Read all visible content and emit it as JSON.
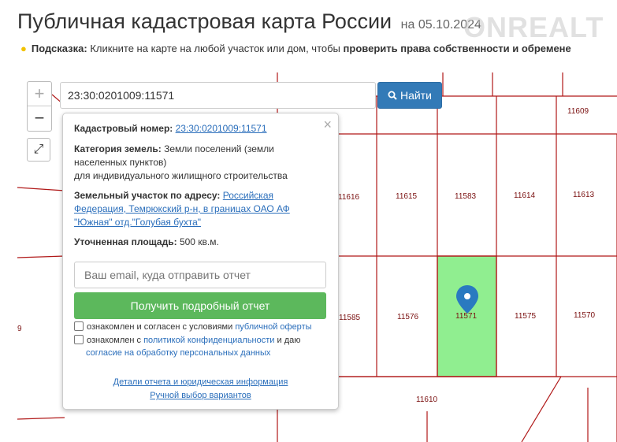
{
  "header": {
    "title": "Публичная кадастровая карта России",
    "date": "на 05.10.2024",
    "watermark": "ONREALT"
  },
  "hint": {
    "label": "Подсказка:",
    "text": "Кликните на карте на любой участок или дом, чтобы",
    "bold_text": "проверить права собственности и обремене"
  },
  "search": {
    "value": "23:30:0201009:11571",
    "button_label": "Найти",
    "button_icon": "search-icon"
  },
  "map_controls": {
    "zoom_in": "+",
    "zoom_out": "−",
    "fullscreen": "⤢"
  },
  "popup": {
    "close": "×",
    "cadastral_label": "Кадастровый номер:",
    "cadastral_value": "23:30:0201009:11571",
    "category_label": "Категория земель:",
    "category_value_line1": "Земли поселений (земли",
    "category_value_line2": "населенных пунктов)",
    "category_value_line3": "для индивидуального жилищного строительства",
    "address_label": "Земельный участок по адресу:",
    "address_line1": "Российская",
    "address_line2": "Федерация, Темрюкский р-н, в границах ОАО АФ",
    "address_line3": "\"Южная\" отд.\"Голубая бухта\"",
    "area_label": "Уточненная площадь:",
    "area_value": "500 кв.м.",
    "email_placeholder": "Ваш email, куда отправить отчет",
    "report_button": "Получить подробный отчет",
    "consent1_text": "ознакомлен и согласен с условиями",
    "consent1_link": "публичной оферты",
    "consent2_text": "ознакомлен с",
    "consent2_link": "политикой конфиденциальности",
    "consent2_text2": "и даю",
    "consent2_link2": "согласие на обработку персональных данных",
    "details_link": "Детали отчета и юридическая информация",
    "manual_link": "Ручной выбор вариантов"
  },
  "parcels": {
    "p11609": "11609",
    "p11616": "11616",
    "p11615": "11615",
    "p11583": "11583",
    "p11614": "11614",
    "p11613": "11613",
    "p11585": "11585",
    "p11576": "11576",
    "p11571": "11571",
    "p11575": "11575",
    "p11570": "11570",
    "p11610": "11610",
    "edge9": "9"
  },
  "colors": {
    "parcel_line": "#b01818",
    "selected_fill": "#90ee90",
    "marker": "#2a7ac0",
    "search_button": "#337ab7",
    "report_button": "#5cb85c"
  }
}
